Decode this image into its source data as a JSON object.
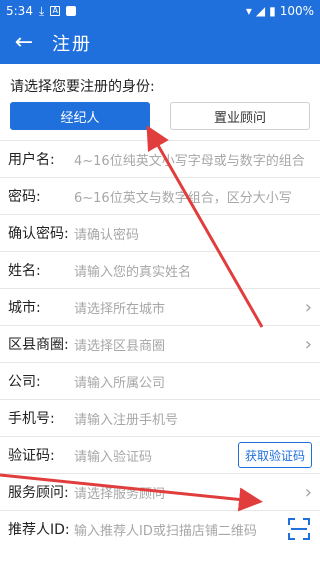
{
  "status_bar": {
    "time": "5:34",
    "battery": "100%"
  },
  "appbar": {
    "title": "注册"
  },
  "prompt": "请选择您要注册的身份:",
  "roles": [
    {
      "label": "经纪人",
      "selected": true
    },
    {
      "label": "置业顾问",
      "selected": false
    }
  ],
  "fields": {
    "username": {
      "label": "用户名:",
      "placeholder": "4~16位纯英文小写字母或与数字的组合"
    },
    "password": {
      "label": "密码:",
      "placeholder": "6~16位英文与数字组合，区分大小写"
    },
    "confirm_password": {
      "label": "确认密码:",
      "placeholder": "请确认密码"
    },
    "name": {
      "label": "姓名:",
      "placeholder": "请输入您的真实姓名"
    },
    "city": {
      "label": "城市:",
      "placeholder": "请选择所在城市"
    },
    "district": {
      "label": "区县商圈:",
      "placeholder": "请选择区县商圈"
    },
    "company": {
      "label": "公司:",
      "placeholder": "请输入所属公司"
    },
    "phone": {
      "label": "手机号:",
      "placeholder": "请输入注册手机号"
    },
    "code": {
      "label": "验证码:",
      "placeholder": "请输入验证码",
      "button": "获取验证码"
    },
    "advisor": {
      "label": "服务顾问:",
      "placeholder": "请选择服务顾问"
    },
    "referrer": {
      "label": "推荐人ID:",
      "placeholder": "输入推荐人ID或扫描店铺二维码"
    }
  },
  "colors": {
    "primary": "#1f6fdc",
    "annotation": "#e23d3d"
  }
}
